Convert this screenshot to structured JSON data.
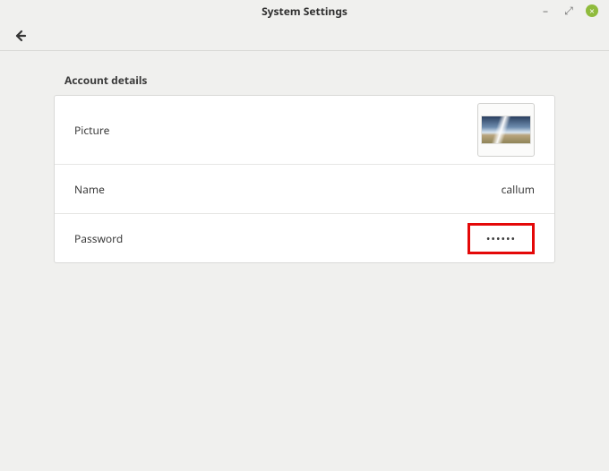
{
  "window": {
    "title": "System Settings",
    "controls": {
      "minimize_glyph": "–",
      "maximize_glyph": "⤢",
      "close_glyph": "×"
    }
  },
  "section": {
    "title": "Account details"
  },
  "rows": {
    "picture": {
      "label": "Picture"
    },
    "name": {
      "label": "Name",
      "value": "callum"
    },
    "password": {
      "label": "Password",
      "value": "••••••"
    }
  }
}
